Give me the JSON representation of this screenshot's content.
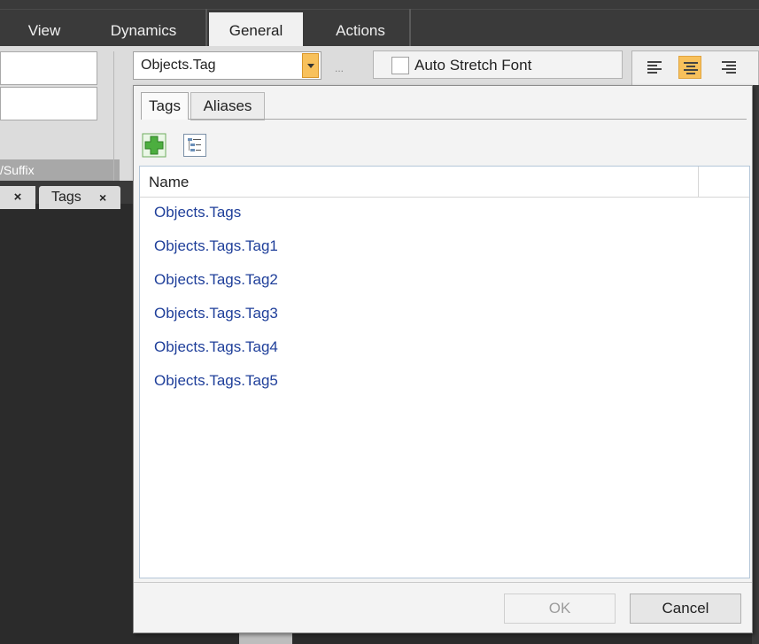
{
  "ribbon_tabs": [
    "View",
    "Dynamics",
    "General",
    "Actions"
  ],
  "ribbon": {
    "group_label": "/Suffix",
    "tag_combo_value": "Objects.Tag",
    "ellipsis_label": "...",
    "auto_stretch_font_label": "Auto Stretch Font",
    "auto_stretch_font_checked": false,
    "alignment_selected": "center"
  },
  "doc_tabs": {
    "close_glyph": "×",
    "tags_label": "Tags",
    "tags_close": "×"
  },
  "popup": {
    "tabs": [
      "Tags",
      "Aliases"
    ],
    "active_tab": "Tags",
    "grid_header": "Name",
    "rows": [
      "Objects.Tags",
      "Objects.Tags.Tag1",
      "Objects.Tags.Tag2",
      "Objects.Tags.Tag3",
      "Objects.Tags.Tag4",
      "Objects.Tags.Tag5"
    ],
    "ok_label": "OK",
    "cancel_label": "Cancel"
  },
  "colors": {
    "accent": "#f8c15c",
    "link": "#1f3f9a",
    "add_icon_green": "#4cae3f"
  },
  "icons": [
    "add-icon",
    "tree-view-icon",
    "dropdown-arrow-icon",
    "align-left-icon",
    "align-center-icon",
    "align-right-icon",
    "close-icon"
  ]
}
